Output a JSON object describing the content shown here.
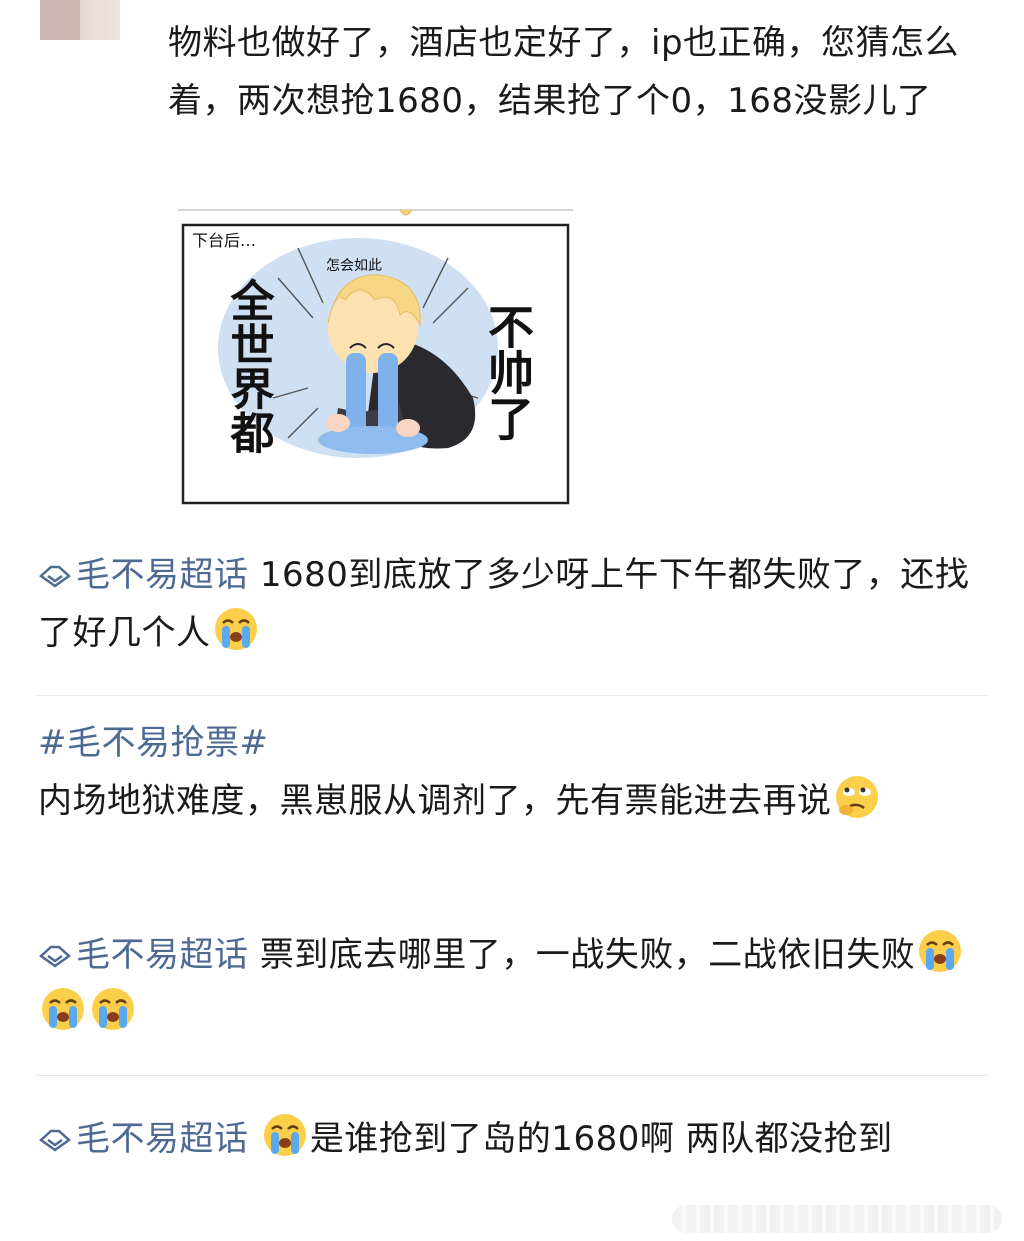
{
  "post": {
    "text": "物料也做好了，酒店也定好了，ip也正确，您猜怎么着，两次想抢1680，结果抢了个0，168没影儿了"
  },
  "meme": {
    "caption_corner": "下台后…",
    "caption_small": "怎会如此",
    "left_text": "全世界都",
    "right_text": "不帅了"
  },
  "comments": [
    {
      "topic": "毛不易超话",
      "text": "1680到底放了多少呀上午下午都失败了，还找了好几个人",
      "emojis": [
        "crying-face-emoji"
      ]
    },
    {
      "topic": "#毛不易抢票#",
      "text": "内场地狱难度，黑崽服从调剂了，先有票能进去再说",
      "emojis": [
        "thinking-rolling-eyes-emoji"
      ]
    },
    {
      "topic": "毛不易超话",
      "text": "票到底去哪里了，一战失败，二战依旧失败",
      "emojis": [
        "crying-face-emoji",
        "crying-face-emoji",
        "crying-face-emoji"
      ]
    },
    {
      "topic": "毛不易超话",
      "text_after_emoji": "是谁抢到了岛的1680啊 两队都没抢到",
      "emojis": [
        "crying-face-emoji"
      ]
    }
  ],
  "colors": {
    "topic_link": "#4d6a93",
    "text": "#1a1a1a",
    "divider": "#e6e6e6"
  }
}
